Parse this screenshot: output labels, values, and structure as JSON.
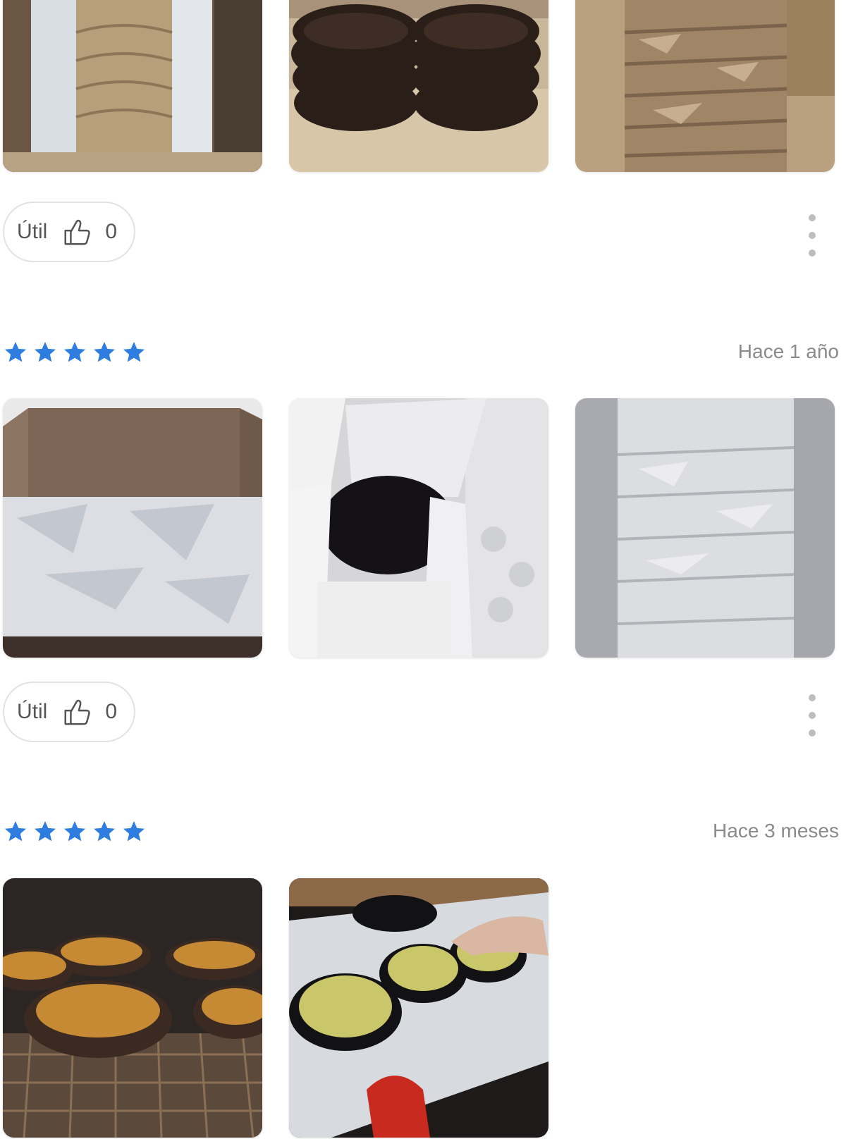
{
  "reviews": [
    {
      "photos": [
        "bread-in-box",
        "stacked-dark-bowls",
        "paper-wrapped-stack"
      ],
      "helpful_label": "Útil",
      "helpful_count": "0"
    },
    {
      "rating": 5,
      "date": "Hace 1 año",
      "photos": [
        "open-box-white-paper",
        "bowl-in-white-paper",
        "wrapped-bowls-column"
      ],
      "helpful_label": "Útil",
      "helpful_count": "0"
    },
    {
      "rating": 5,
      "date": "Hace 3 meses",
      "photos": [
        "bowls-in-oven",
        "filled-bowls-on-counter"
      ]
    }
  ],
  "colors": {
    "star": "#2f7de1",
    "date": "#8a8a8a",
    "button_border": "#e2e2e2"
  }
}
